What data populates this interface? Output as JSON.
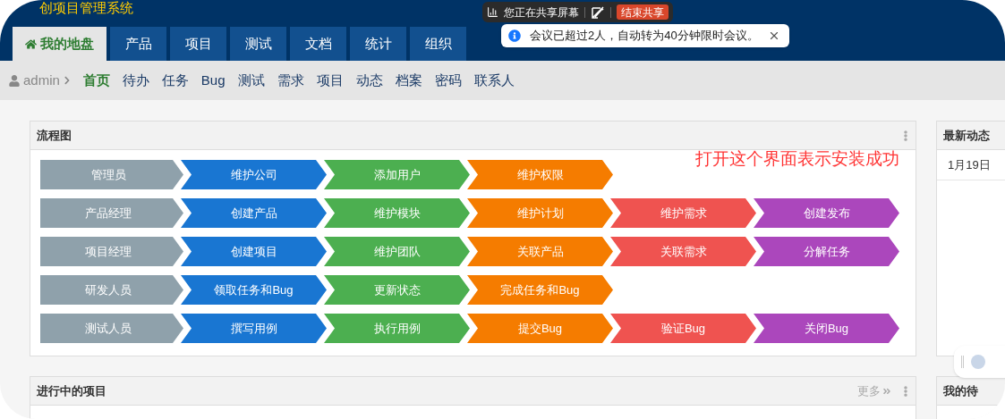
{
  "app_title": "创项目管理系统",
  "screen_share": {
    "status": "您正在共享屏幕",
    "stop_button": "结束共享"
  },
  "notice": {
    "message": "会议已超过2人，自动转为40分钟限时会议。"
  },
  "main_tabs": [
    {
      "label": "我的地盘",
      "selected": true
    },
    {
      "label": "产品",
      "selected": false
    },
    {
      "label": "项目",
      "selected": false
    },
    {
      "label": "测试",
      "selected": false
    },
    {
      "label": "文档",
      "selected": false
    },
    {
      "label": "统计",
      "selected": false
    },
    {
      "label": "组织",
      "selected": false
    }
  ],
  "breadcrumb": {
    "user": "admin"
  },
  "sub_nav": [
    {
      "label": "首页",
      "selected": true
    },
    {
      "label": "待办",
      "selected": false
    },
    {
      "label": "任务",
      "selected": false
    },
    {
      "label": "Bug",
      "selected": false
    },
    {
      "label": "测试",
      "selected": false
    },
    {
      "label": "需求",
      "selected": false
    },
    {
      "label": "项目",
      "selected": false
    },
    {
      "label": "动态",
      "selected": false
    },
    {
      "label": "档案",
      "selected": false
    },
    {
      "label": "密码",
      "selected": false
    },
    {
      "label": "联系人",
      "selected": false
    }
  ],
  "flowchart": {
    "title": "流程图",
    "rows": [
      {
        "role": "管理员",
        "steps": [
          {
            "label": "维护公司",
            "color": "#1976d2"
          },
          {
            "label": "添加用户",
            "color": "#4caf50"
          },
          {
            "label": "维护权限",
            "color": "#f57c00"
          }
        ]
      },
      {
        "role": "产品经理",
        "steps": [
          {
            "label": "创建产品",
            "color": "#1976d2"
          },
          {
            "label": "维护模块",
            "color": "#4caf50"
          },
          {
            "label": "维护计划",
            "color": "#f57c00"
          },
          {
            "label": "维护需求",
            "color": "#ef5350"
          },
          {
            "label": "创建发布",
            "color": "#ab47bc"
          }
        ]
      },
      {
        "role": "项目经理",
        "steps": [
          {
            "label": "创建项目",
            "color": "#1976d2"
          },
          {
            "label": "维护团队",
            "color": "#4caf50"
          },
          {
            "label": "关联产品",
            "color": "#f57c00"
          },
          {
            "label": "关联需求",
            "color": "#ef5350"
          },
          {
            "label": "分解任务",
            "color": "#ab47bc"
          }
        ]
      },
      {
        "role": "研发人员",
        "steps": [
          {
            "label": "领取任务和Bug",
            "color": "#1976d2"
          },
          {
            "label": "更新状态",
            "color": "#4caf50"
          },
          {
            "label": "完成任务和Bug",
            "color": "#f57c00"
          }
        ]
      },
      {
        "role": "测试人员",
        "steps": [
          {
            "label": "撰写用例",
            "color": "#1976d2"
          },
          {
            "label": "执行用例",
            "color": "#4caf50"
          },
          {
            "label": "提交Bug",
            "color": "#f57c00"
          },
          {
            "label": "验证Bug",
            "color": "#ef5350"
          },
          {
            "label": "关闭Bug",
            "color": "#ab47bc"
          }
        ]
      }
    ]
  },
  "annotation": "打开这个界面表示安装成功",
  "latest_activity": {
    "title": "最新动态",
    "entries": [
      "1月19日"
    ]
  },
  "projects": {
    "title": "进行中的项目",
    "more": "更多"
  },
  "todo": {
    "title": "我的待"
  }
}
